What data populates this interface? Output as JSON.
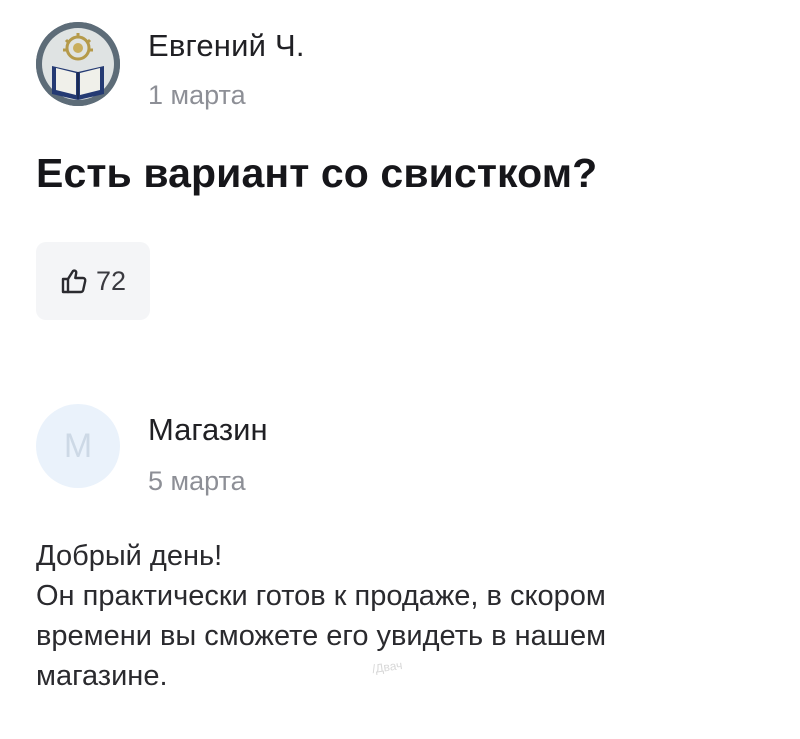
{
  "review": {
    "author_name": "Евгений Ч.",
    "date": "1 марта",
    "text": "Есть вариант со свистком?",
    "like_icon": "thumbs-up-icon",
    "likes": "72"
  },
  "reply": {
    "avatar_letter": "М",
    "shop_name": "Магазин",
    "date": "5 марта",
    "lines": [
      "Добрый день!",
      "Он практически готов к продаже, в скором",
      "времени вы сможете его увидеть в нашем",
      "магазине."
    ]
  },
  "watermark": "/Двач",
  "colors": {
    "text_primary": "#202024",
    "text_secondary": "#8d8f96",
    "like_bg": "#f4f5f7",
    "shop_avatar_bg": "#eaf2fb"
  }
}
